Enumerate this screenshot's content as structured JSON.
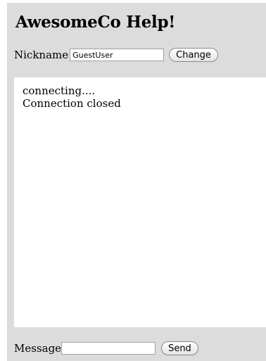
{
  "app": {
    "title": "AwesomeCo Help!"
  },
  "nickname": {
    "label": "Nickname",
    "value": "GuestUser",
    "button": "Change"
  },
  "log": {
    "lines": [
      "connecting....",
      "Connection closed"
    ]
  },
  "message": {
    "label": "Message",
    "value": "",
    "button": "Send"
  }
}
